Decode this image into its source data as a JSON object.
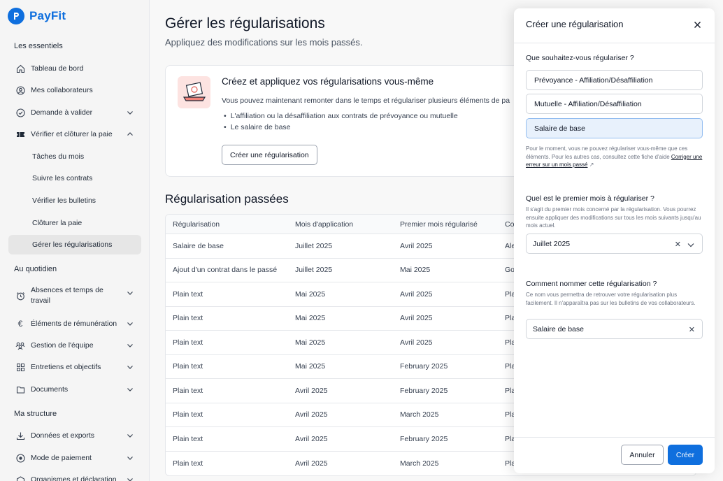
{
  "app": {
    "name": "PayFit"
  },
  "sidebar": {
    "sections": [
      {
        "title": "Les essentiels"
      },
      {
        "title": "Au quotidien"
      },
      {
        "title": "Ma structure"
      }
    ],
    "items": [
      {
        "label": "Tableau de bord"
      },
      {
        "label": "Mes collaborateurs"
      },
      {
        "label": "Demande à valider"
      },
      {
        "label": "Vérifier et clôturer la paie"
      },
      {
        "label": "Tâches du mois"
      },
      {
        "label": "Suivre les contrats"
      },
      {
        "label": "Vérifier les bulletins"
      },
      {
        "label": "Clôturer la paie"
      },
      {
        "label": "Gérer les régularisations"
      },
      {
        "label": "Absences et temps de travail"
      },
      {
        "label": "Éléments de rémunération"
      },
      {
        "label": "Gestion de l'équipe"
      },
      {
        "label": "Entretiens et objectifs"
      },
      {
        "label": "Documents"
      },
      {
        "label": "Données et exports"
      },
      {
        "label": "Mode de paiement"
      },
      {
        "label": "Organismes et déclaration"
      }
    ]
  },
  "main": {
    "title": "Gérer les régularisations",
    "subtitle": "Appliquez des modifications sur les mois passés.",
    "card": {
      "title": "Créez et appliquez vos régularisations vous-même",
      "text": "Vous pouvez maintenant remonter dans le temps et régulariser plusieurs éléments de pa",
      "bullets": [
        "L'affiliation ou la désaffiliation aux contrats de prévoyance ou mutuelle",
        "Le salaire de base"
      ],
      "button": "Créer une régularisation"
    },
    "past_title": "Régularisation passées",
    "table": {
      "headers": [
        "Régularisation",
        "Mois d'application",
        "Premier mois régularisé",
        "Co"
      ],
      "rows": [
        [
          "Salaire de base",
          "Juillet 2025",
          "Avril 2025",
          "Ale"
        ],
        [
          "Ajout d'un contrat dans le passé",
          "Juillet 2025",
          "Mai 2025",
          "Go"
        ],
        [
          "Plain text",
          "Mai 2025",
          "Avril 2025",
          "Pla"
        ],
        [
          "Plain text",
          "Mai 2025",
          "Avril 2025",
          "Pla"
        ],
        [
          "Plain text",
          "Mai 2025",
          "Avril 2025",
          "Pla"
        ],
        [
          "Plain text",
          "Mai 2025",
          "February 2025",
          "Pla"
        ],
        [
          "Plain text",
          "Avril 2025",
          "February 2025",
          "Pla"
        ],
        [
          "Plain text",
          "Avril 2025",
          "March 2025",
          "Pla"
        ],
        [
          "Plain text",
          "Avril 2025",
          "February 2025",
          "Pla"
        ],
        [
          "Plain text",
          "Avril 2025",
          "March 2025",
          "Pla"
        ]
      ]
    }
  },
  "drawer": {
    "title": "Créer une régularisation",
    "q1": "Que souhaitez-vous régulariser ?",
    "options": [
      "Prévoyance - Affiliation/Désaffiliation",
      "Mutuelle - Affiliation/Désaffiliation",
      "Salaire de base"
    ],
    "help1_text": "Pour le moment, vous ne pouvez régulariser vous-même que ces éléments. Pour les autres cas, consultez cette fiche d'aide ",
    "help1_link": "Corriger une erreur sur un mois passé",
    "q2": "Quel est le premier mois à régulariser ?",
    "help2": "Il s'agit du premier mois concerné par la régularisation. Vous pourrez ensuite appliquer des modifications sur tous les mois suivants jusqu'au mois actuel.",
    "month_value": "Juillet 2025",
    "q3": "Comment nommer cette régularisation ?",
    "help3": "Ce nom vous permettra de retrouver votre régularisation plus facilement. Il n'apparaîtra pas sur les bulletins de vos collaborateurs.",
    "name_value": "Salaire de base",
    "cancel": "Annuler",
    "create": "Créer"
  }
}
